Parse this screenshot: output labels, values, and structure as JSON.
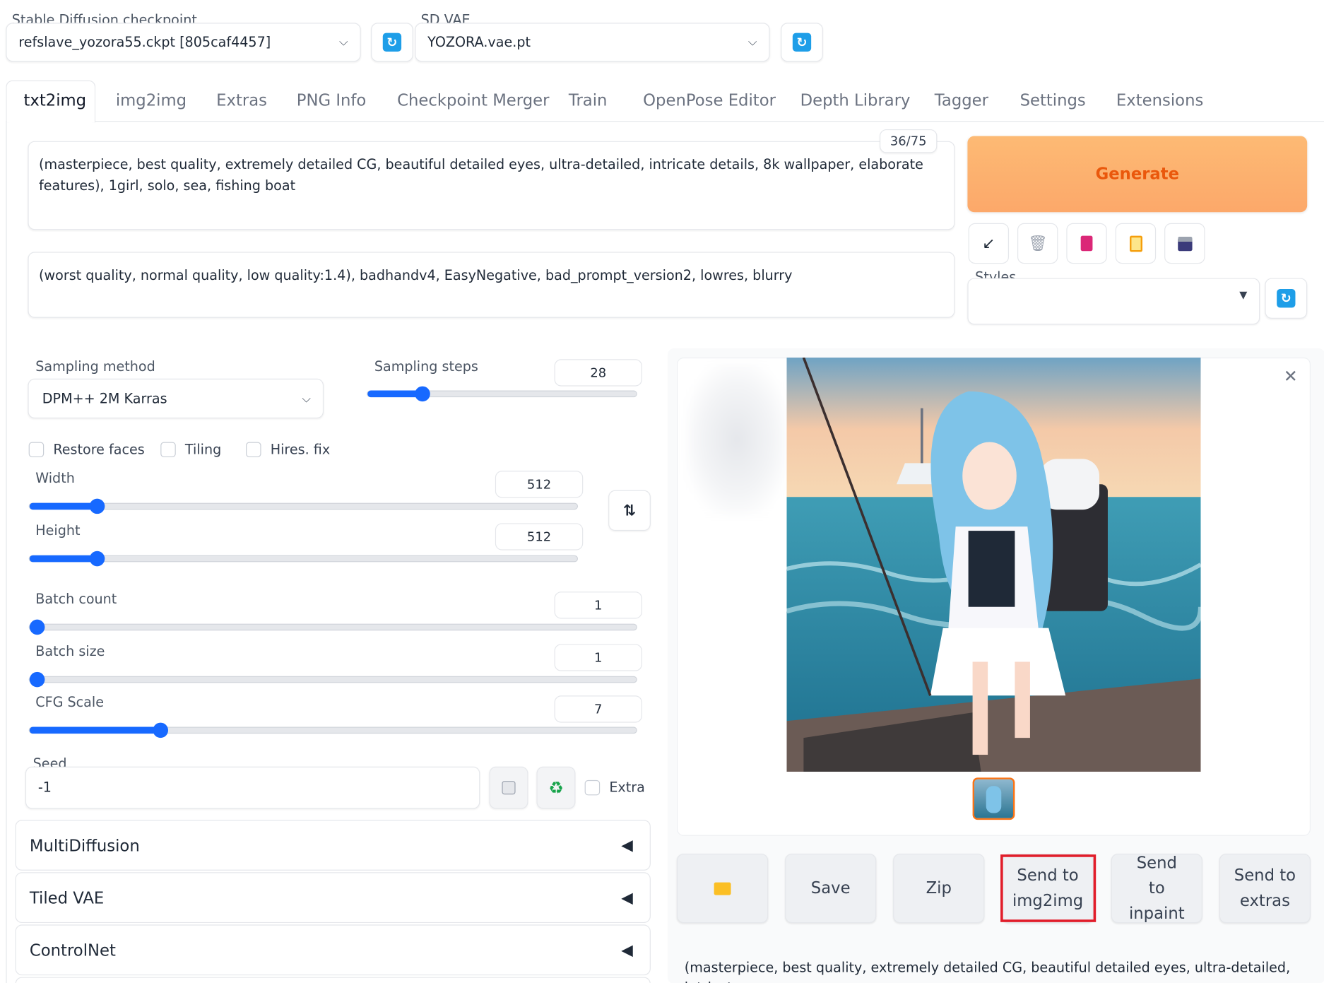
{
  "top": {
    "checkpoint_label": "Stable Diffusion checkpoint",
    "checkpoint_value": "refslave_yozora55.ckpt [805caf4457]",
    "vae_label": "SD VAE",
    "vae_value": "YOZORA.vae.pt"
  },
  "tabs": [
    "txt2img",
    "img2img",
    "Extras",
    "PNG Info",
    "Checkpoint Merger",
    "Train",
    "OpenPose Editor",
    "Depth Library",
    "Tagger",
    "Settings",
    "Extensions"
  ],
  "prompt": {
    "positive": "(masterpiece, best quality, extremely detailed CG, beautiful detailed eyes, ultra-detailed, intricate details, 8k wallpaper, elaborate features), 1girl, solo, sea, fishing boat",
    "token_count": "36/75",
    "negative": "(worst quality, normal quality, low quality:1.4), badhandv4, EasyNegative, bad_prompt_version2, lowres, blurry"
  },
  "actions": {
    "generate": "Generate",
    "styles_label": "Styles"
  },
  "settings": {
    "sampling_method_label": "Sampling method",
    "sampling_method_value": "DPM++ 2M Karras",
    "sampling_steps_label": "Sampling steps",
    "sampling_steps_value": "28",
    "restore_faces": "Restore faces",
    "tiling": "Tiling",
    "hires_fix": "Hires. fix",
    "width_label": "Width",
    "width_value": "512",
    "height_label": "Height",
    "height_value": "512",
    "batch_count_label": "Batch count",
    "batch_count_value": "1",
    "batch_size_label": "Batch size",
    "batch_size_value": "1",
    "cfg_label": "CFG Scale",
    "cfg_value": "7",
    "seed_label": "Seed",
    "seed_value": "-1",
    "extra_label": "Extra"
  },
  "accordions": [
    "MultiDiffusion",
    "Tiled VAE",
    "ControlNet"
  ],
  "output": {
    "buttons": [
      "Save",
      "Zip",
      "Send to img2img",
      "Send to inpaint",
      "Send to extras"
    ],
    "info_text": "(masterpiece, best quality, extremely detailed CG, beautiful detailed eyes, ultra-detailed, intricate"
  },
  "colors": {
    "accent": "#1769ff",
    "generate": "#f97316",
    "highlight": "#e11d2a"
  }
}
